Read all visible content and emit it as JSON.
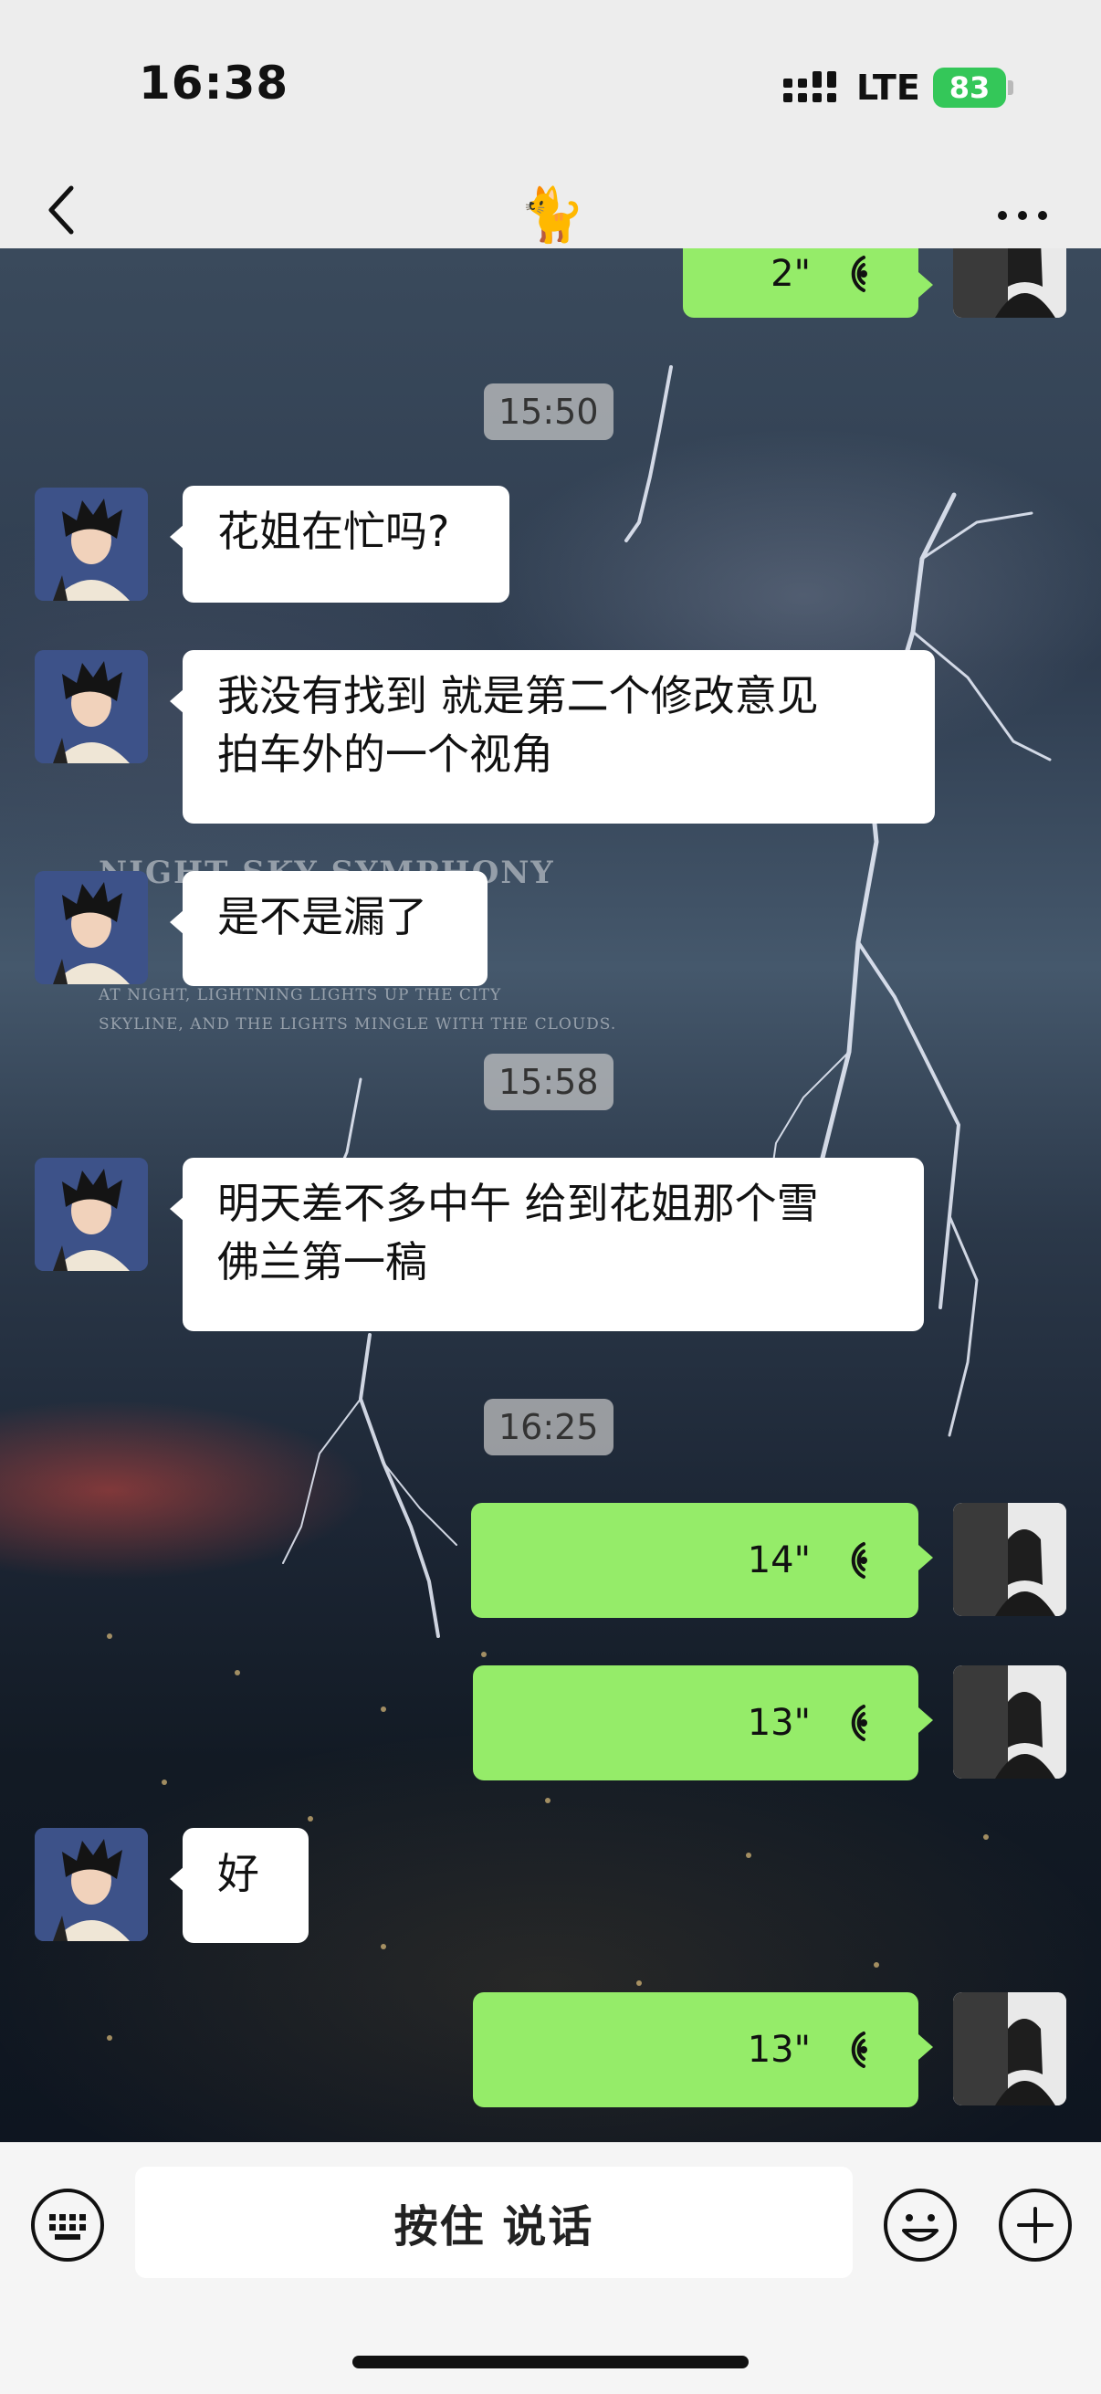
{
  "status": {
    "time": "16:38",
    "network": "LTE",
    "battery": "83"
  },
  "header": {
    "title": "🐈"
  },
  "watermark": {
    "title": "NIGHT SKY SYMPHONY",
    "line1": "AT NIGHT, LIGHTNING LIGHTS UP THE CITY",
    "line2": "SKYLINE, AND THE LIGHTS MINGLE WITH THE CLOUDS."
  },
  "messages": {
    "m0": {
      "duration": "2\""
    },
    "t1": "15:50",
    "m1": {
      "text": "花姐在忙吗?"
    },
    "m2": {
      "line1": "我没有找到 就是第二个修改意见",
      "line2": "拍车外的一个视角"
    },
    "m3": {
      "text": "是不是漏了"
    },
    "t2": "15:58",
    "m4": {
      "line1": "明天差不多中午 给到花姐那个雪",
      "line2": "佛兰第一稿"
    },
    "t3": "16:25",
    "m5": {
      "duration": "14\""
    },
    "m6": {
      "duration": "13\""
    },
    "m7": {
      "text": "好"
    },
    "m8": {
      "duration": "13\""
    }
  },
  "input": {
    "hold_to_talk": "按住 说话"
  },
  "colors": {
    "voice_bubble": "#95ec69",
    "battery": "#34c759"
  }
}
